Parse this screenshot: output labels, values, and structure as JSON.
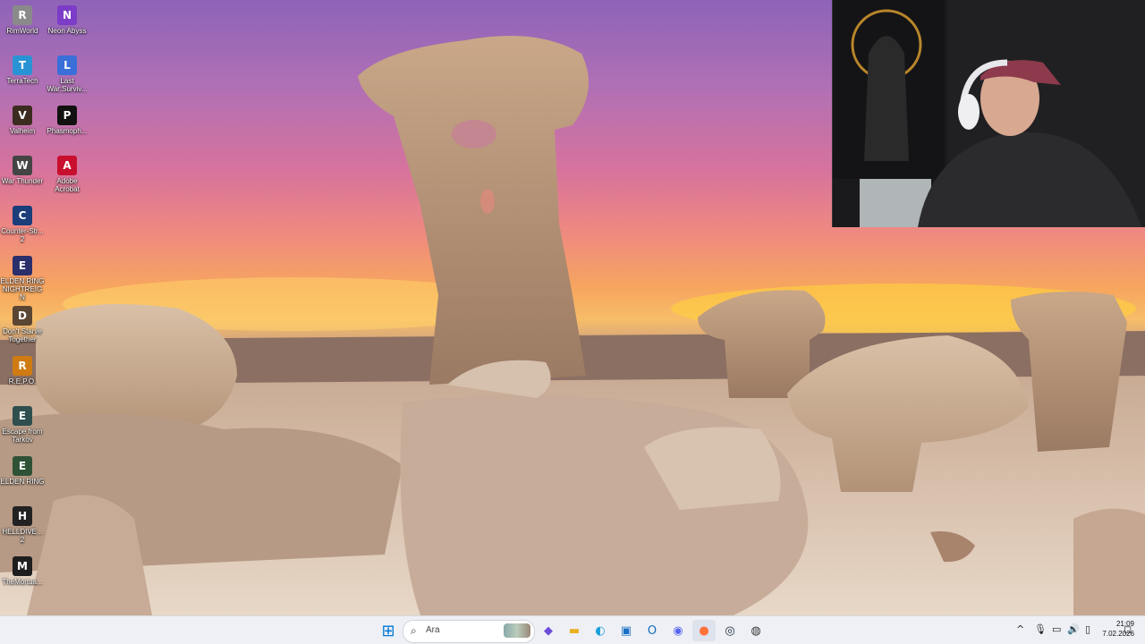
{
  "desktop_icons": [
    {
      "name": "desktop-icon-rimworld",
      "label": "RimWorld",
      "glyph": "R",
      "color": "#8a8a8a"
    },
    {
      "name": "desktop-icon-neon-abyss",
      "label": "Neon Abyss",
      "glyph": "N",
      "color": "#7d3cc8"
    },
    {
      "name": "desktop-icon-terratech",
      "label": "TerraTech",
      "glyph": "T",
      "color": "#2a93d5"
    },
    {
      "name": "desktop-icon-last-war",
      "label": "Last War:Surviv...",
      "glyph": "L",
      "color": "#3a6fd8"
    },
    {
      "name": "desktop-icon-valheim",
      "label": "Valheim",
      "glyph": "V",
      "color": "#3c2c20"
    },
    {
      "name": "desktop-icon-phasmophobia",
      "label": "Phasmoph...",
      "glyph": "P",
      "color": "#111111"
    },
    {
      "name": "desktop-icon-war-thunder",
      "label": "War Thunder",
      "glyph": "W",
      "color": "#444444"
    },
    {
      "name": "desktop-icon-adobe-acrobat",
      "label": "Adobe Acrobat",
      "glyph": "A",
      "color": "#c8102e"
    },
    {
      "name": "desktop-icon-counter-strike",
      "label": "Counter-Str... 2",
      "glyph": "C",
      "color": "#1b3d7a"
    },
    {
      "name": "desktop-icon-elden-ring-nightreign",
      "label": "ELDEN RING NIGHTREIGN",
      "glyph": "E",
      "color": "#2b2f6a"
    },
    {
      "name": "desktop-icon-dont-starve-together",
      "label": "Don't Starve Together",
      "glyph": "D",
      "color": "#5a4632"
    },
    {
      "name": "desktop-icon-repo",
      "label": "R.E.P.O.",
      "glyph": "R",
      "color": "#d07b12"
    },
    {
      "name": "desktop-icon-escape-from-tarkov",
      "label": "Escape from Tarkov",
      "glyph": "E",
      "color": "#2f4f4f"
    },
    {
      "name": "desktop-icon-elden-ring",
      "label": "ELDEN RING",
      "glyph": "E",
      "color": "#2f5236"
    },
    {
      "name": "desktop-icon-helldivers-2",
      "label": "HELLDIVE... 2",
      "glyph": "H",
      "color": "#222222"
    },
    {
      "name": "desktop-icon-the-mortuary",
      "label": "TheMortua...",
      "glyph": "M",
      "color": "#1e1e1e"
    }
  ],
  "taskbar": {
    "search_placeholder": "Ara",
    "apps": [
      {
        "name": "start-button",
        "icon": "windows-logo-icon",
        "glyph": "⊞",
        "color": "#0078d4"
      },
      {
        "name": "taskbar-widgets",
        "icon": "widgets-icon",
        "glyph": "◆",
        "color": "#6b4bd8"
      },
      {
        "name": "taskbar-file-explorer",
        "icon": "folder-icon",
        "glyph": "▬",
        "color": "#e8b020"
      },
      {
        "name": "taskbar-edge",
        "icon": "edge-icon",
        "glyph": "◐",
        "color": "#1a9fd9"
      },
      {
        "name": "taskbar-store",
        "icon": "store-icon",
        "glyph": "▣",
        "color": "#1a6fc4"
      },
      {
        "name": "taskbar-outlook",
        "icon": "outlook-icon",
        "glyph": "O",
        "color": "#0f6cbd"
      },
      {
        "name": "taskbar-discord",
        "icon": "discord-icon",
        "glyph": "◉",
        "color": "#5865f2"
      },
      {
        "name": "taskbar-firefox",
        "icon": "firefox-icon",
        "glyph": "●",
        "color": "#ff7139"
      },
      {
        "name": "taskbar-steam",
        "icon": "steam-icon",
        "glyph": "◎",
        "color": "#1b2838"
      },
      {
        "name": "taskbar-app-notify",
        "icon": "app-icon",
        "glyph": "◍",
        "color": "#333333"
      }
    ],
    "tray": {
      "chevron": "^",
      "mic": "🎙",
      "network": "▭",
      "volume": "🔊",
      "battery": "▯",
      "time": "21:09",
      "date": "7.02.2026"
    }
  }
}
